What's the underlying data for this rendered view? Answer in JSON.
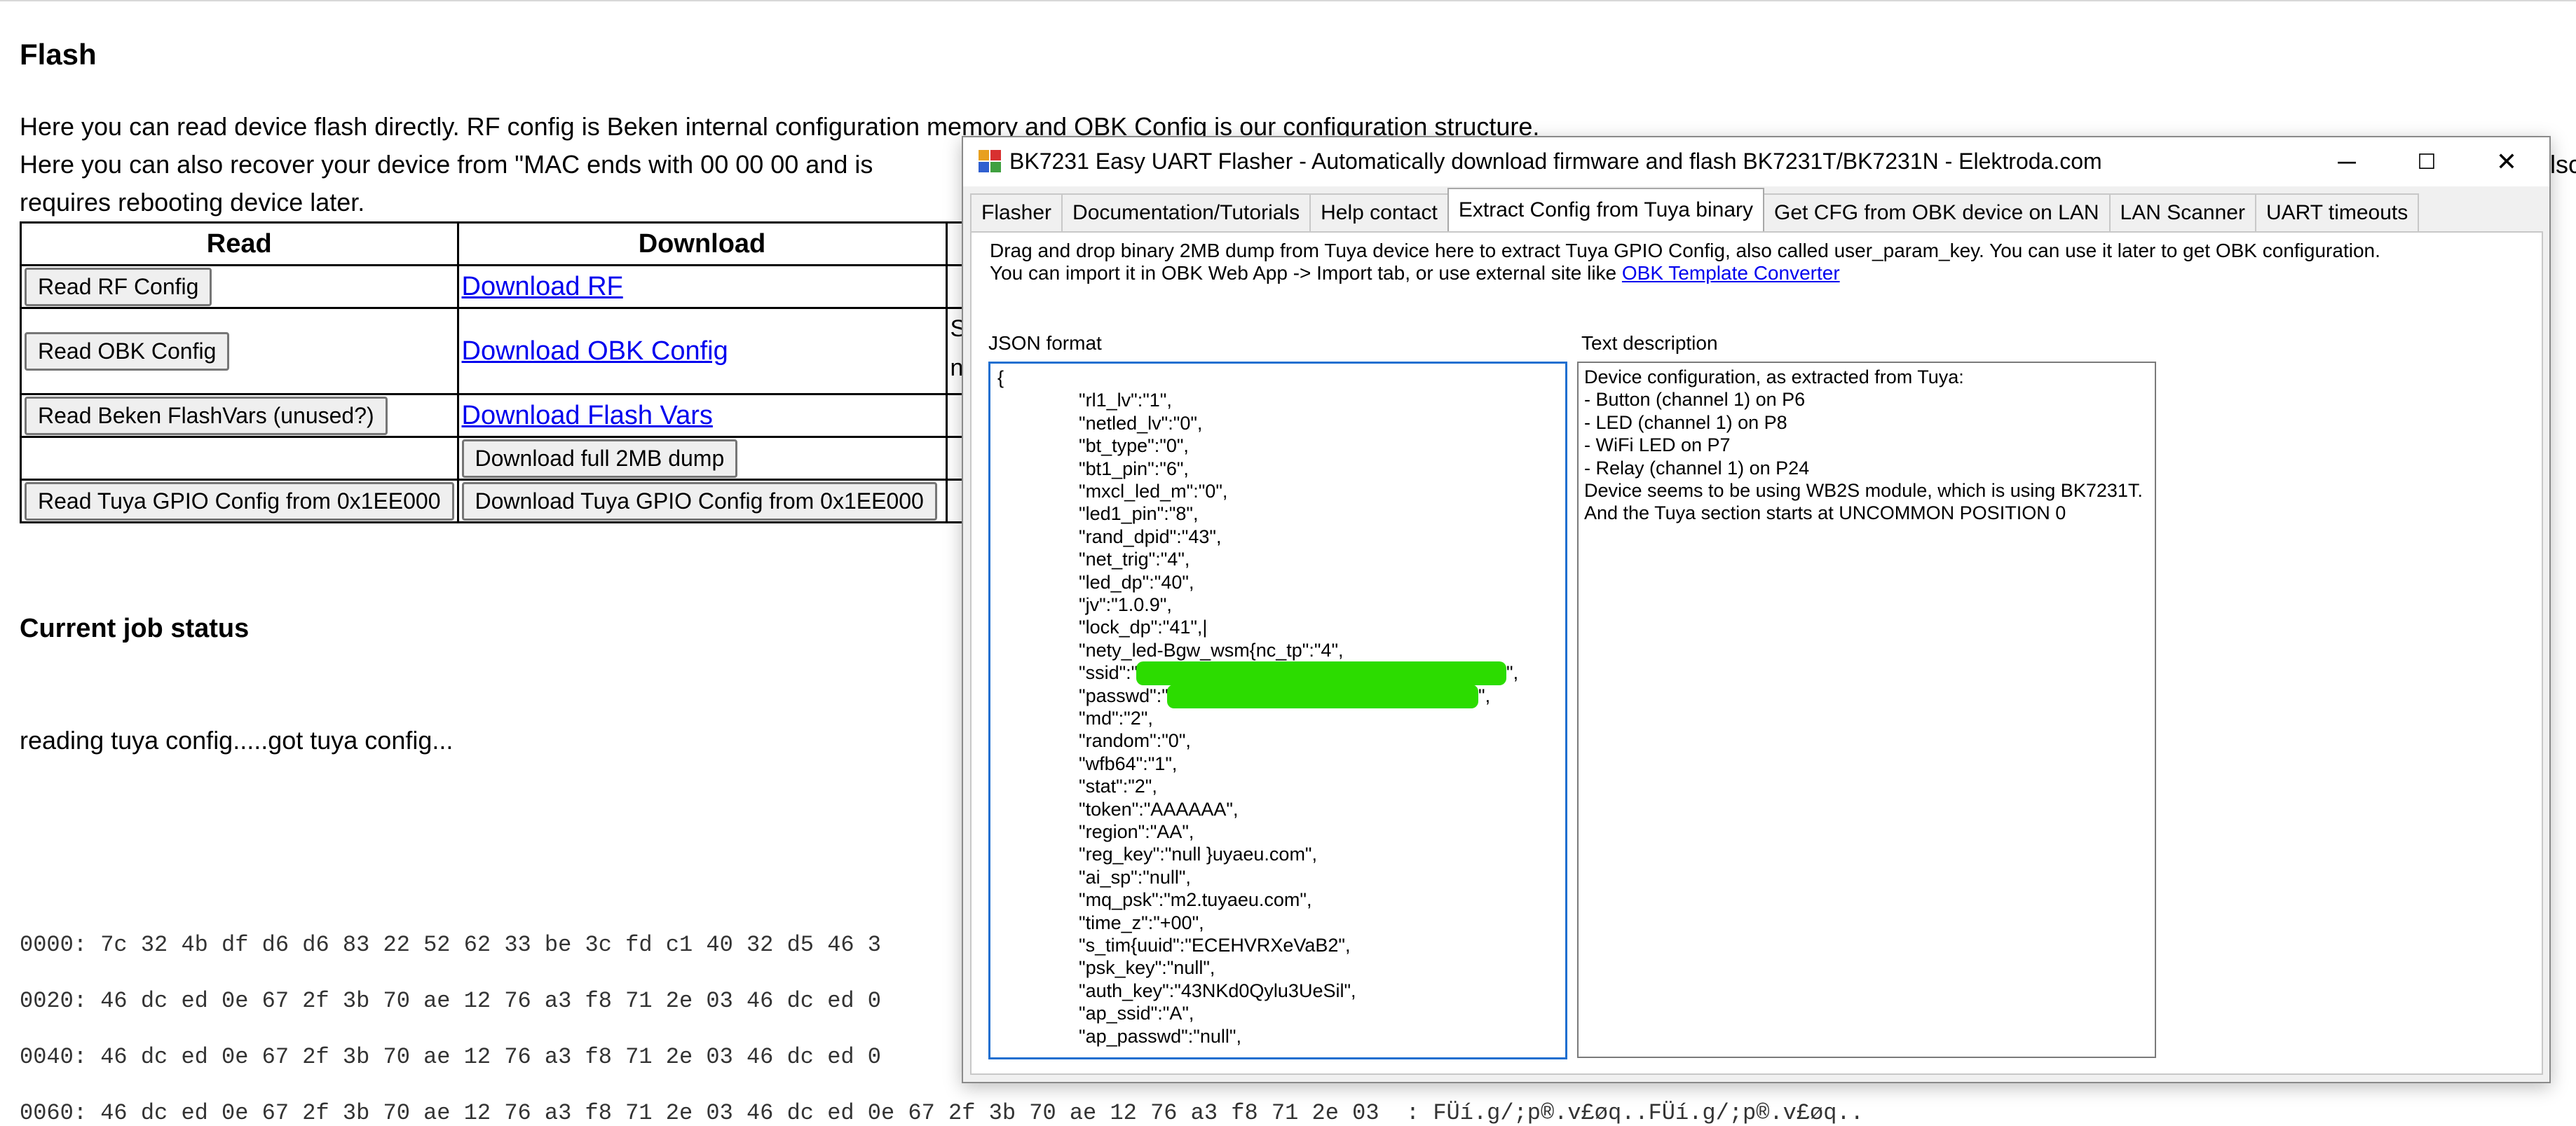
{
  "web": {
    "heading": "Flash",
    "intro_line1": "Here you can read device flash directly. RF config is Beken internal configuration memory and OBK Config is our configuration structure.",
    "intro_line2": "Here you can also recover your device from \"MAC ends with 00 00 00 and is",
    "intro_line2_clip": "lsc",
    "intro_line3": "requires rebooting device later.",
    "table": {
      "headers": [
        "Read",
        "Download"
      ],
      "rows": [
        {
          "read": "Read RF Config",
          "download": "Download RF"
        },
        {
          "read": "Read OBK Config",
          "download": "Download OBK Config",
          "clip1": "S",
          "clip2": "n"
        },
        {
          "read": "Read Beken FlashVars (unused?)",
          "download": "Download Flash Vars"
        },
        {
          "read": "",
          "download": "Download full 2MB dump"
        },
        {
          "read": "Read Tuya GPIO Config from 0x1EE000",
          "download": "Download Tuya GPIO Config from 0x1EE000"
        }
      ]
    },
    "status_heading": "Current job status",
    "status_text": "reading tuya config.....got tuya config...",
    "hex_lines": [
      "0000: 7c 32 4b df d6 d6 83 22 52 62 33 be 3c fd c1 40 32 d5 46 3",
      "0020: 46 dc ed 0e 67 2f 3b 70 ae 12 76 a3 f8 71 2e 03 46 dc ed 0",
      "0040: 46 dc ed 0e 67 2f 3b 70 ae 12 76 a3 f8 71 2e 03 46 dc ed 0",
      "0060: 46 dc ed 0e 67 2f 3b 70 ae 12 76 a3 f8 71 2e 03 46 dc ed 0e 67 2f 3b 70 ae 12 76 a3 f8 71 2e 03  : FÜí.g/;p®.v£øq..FÜí.g/;p®.v£øq.."
    ]
  },
  "dialog": {
    "title": "BK7231 Easy UART Flasher - Automatically download firmware and flash BK7231T/BK7231N  - Elektroda.com",
    "controls": {
      "minimize": "─",
      "maximize": "☐",
      "close": "✕"
    },
    "tabs": [
      {
        "label": "Flasher",
        "active": false
      },
      {
        "label": "Documentation/Tutorials",
        "active": false
      },
      {
        "label": "Help contact",
        "active": false
      },
      {
        "label": "Extract Config from Tuya binary",
        "active": true
      },
      {
        "label": "Get CFG from OBK device on LAN",
        "active": false
      },
      {
        "label": "LAN Scanner",
        "active": false
      },
      {
        "label": "UART timeouts",
        "active": false
      }
    ],
    "desc_line1": "Drag and drop binary 2MB dump from Tuya device here to extract Tuya GPIO Config, also called user_param_key. You can use it later to get OBK configuration.",
    "desc_line2_prefix": "You can import it in OBK Web App -> Import tab, or use external site like ",
    "desc_line2_link": "OBK Template Converter",
    "json_label": "JSON format",
    "text_label": "Text description",
    "json_lines": [
      "{",
      "\"rl1_lv\":\"1\",",
      "\"netled_lv\":\"0\",",
      "\"bt_type\":\"0\",",
      "\"bt1_pin\":\"6\",",
      "\"mxcl_led_m\":\"0\",",
      "\"led1_pin\":\"8\",",
      "\"rand_dpid\":\"43\",",
      "\"net_trig\":\"4\",",
      "\"led_dp\":\"40\",",
      "\"jv\":\"1.0.9\",",
      "\"lock_dp\":\"41\",|",
      "\"nety_led-Bgw_wsm{nc_tp\":\"4\",",
      "\"ssid\":\"",
      "\"passwd\":\"",
      "\"md\":\"2\",",
      "\"random\":\"0\",",
      "\"wfb64\":\"1\",",
      "\"stat\":\"2\",",
      "\"token\":\"AAAAAA\",",
      "\"region\":\"AA\",",
      "\"reg_key\":\"null }uyaeu.com\",",
      "\"ai_sp\":\"null\",",
      "\"mq_psk\":\"m2.tuyaeu.com\",",
      "\"time_z\":\"+00\",",
      "\"s_tim{uuid\":\"ECEHVRXeVaB2\",",
      "\"psk_key\":\"null\",",
      "\"auth_key\":\"43NKd0Qylu3UeSil\",",
      "\"ap_ssid\":\"A\",",
      "\"ap_passwd\":\"null\","
    ],
    "ssid_tail": "\",",
    "passwd_tail": "\",",
    "text_lines": [
      "Device configuration, as extracted from Tuya:",
      "- Button (channel 1) on P6",
      "- LED (channel 1) on P8",
      "- WiFi LED on P7",
      "- Relay (channel 1) on P24",
      "Device seems to be using WB2S module, which is using BK7231T.",
      "And the Tuya section starts at UNCOMMON POSITION 0"
    ],
    "redaction_color": "#2cdc00",
    "accent_border": "#1e6fd0"
  }
}
